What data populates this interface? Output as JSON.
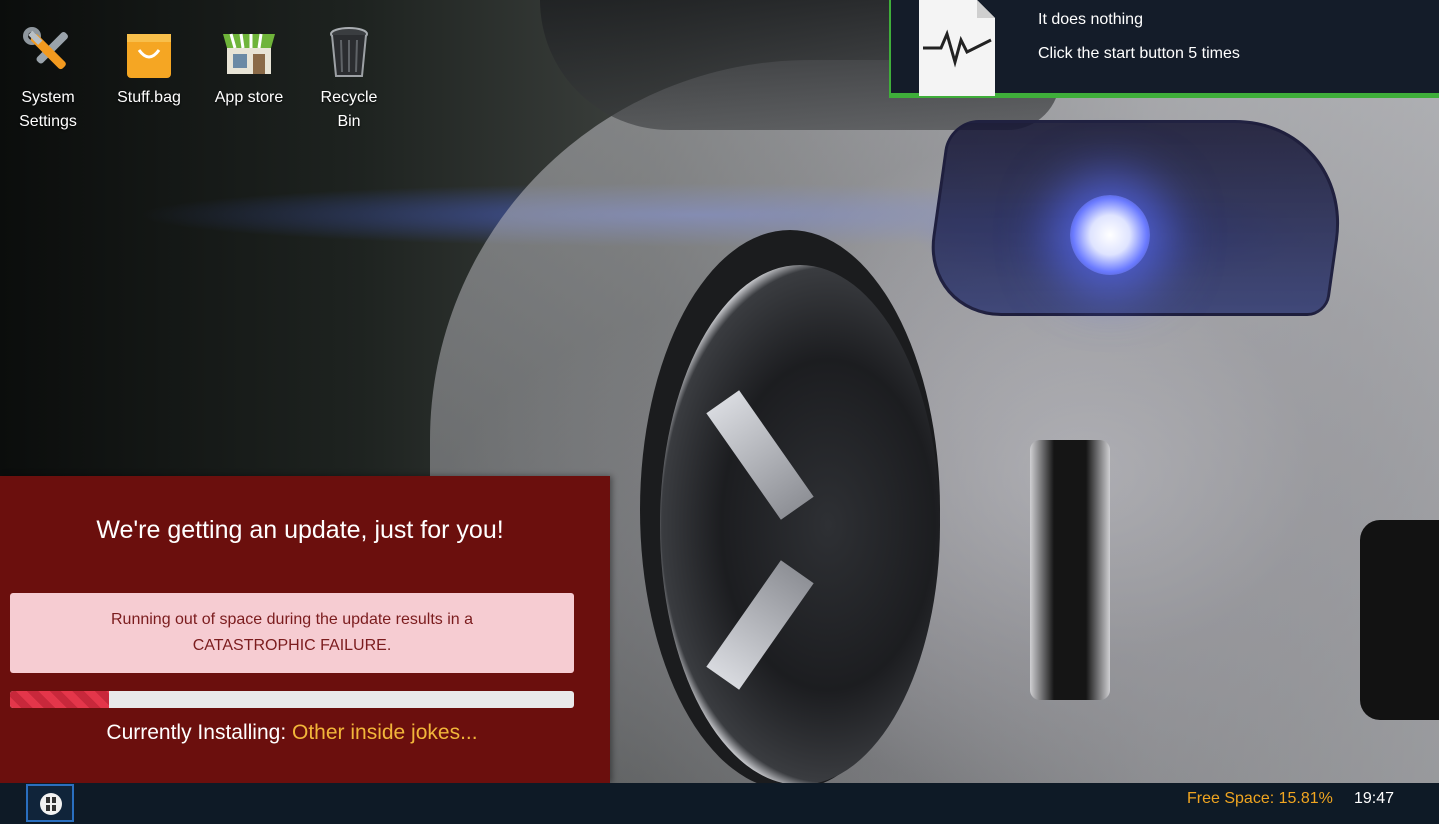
{
  "desktop": {
    "icons": [
      {
        "label": "System\nSettings",
        "icon": "tools-icon"
      },
      {
        "label": "Stuff.bag",
        "icon": "shopping-bag-icon"
      },
      {
        "label": "App store",
        "icon": "store-icon"
      },
      {
        "label": "Recycle\nBin",
        "icon": "trash-can-icon"
      }
    ]
  },
  "notification": {
    "icon": "document-graph-icon",
    "line1": "It does nothing",
    "line2": "Click the start button 5 times",
    "accent_color": "#3fae3a"
  },
  "update_dialog": {
    "title": "We're getting an update, just for you!",
    "warning_line1": "Running out of space during the update results in a",
    "warning_line2": "CATASTROPHIC FAILURE.",
    "progress_fraction": 0.175,
    "installing_label": "Currently Installing:",
    "installing_item": "Other inside jokes...",
    "background_color": "#6b0f0d",
    "item_color": "#f2b63a"
  },
  "taskbar": {
    "start_icon": "start-icon",
    "free_space": "Free Space: 15.81%",
    "clock": "19:47",
    "free_space_color": "#f0a520"
  }
}
